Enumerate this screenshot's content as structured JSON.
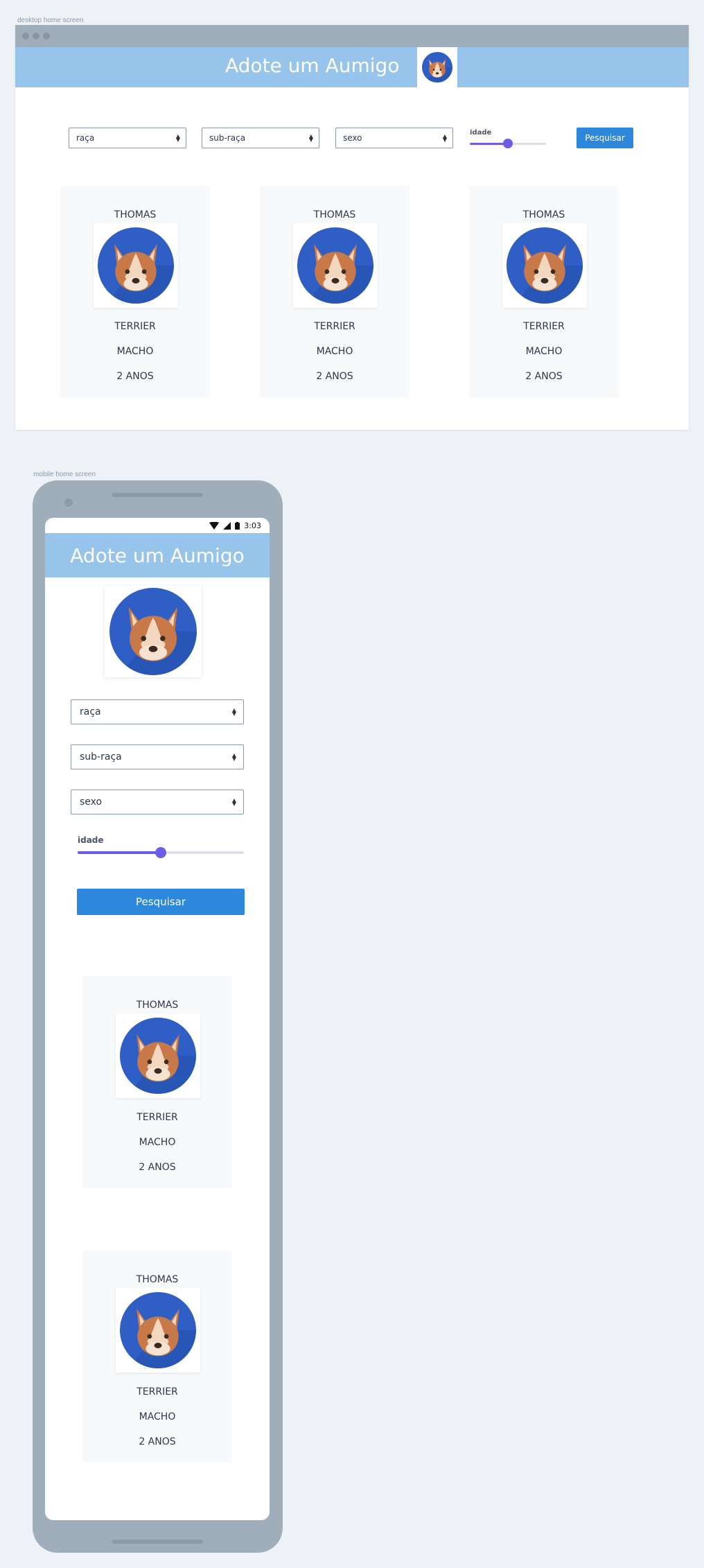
{
  "labels": {
    "desktop_frame": "desktop home screen",
    "mobile_frame": "mobile home screen"
  },
  "app": {
    "title": "Adote um Aumigo"
  },
  "filters": {
    "breed": "raça",
    "sub_breed": "sub-raça",
    "sex": "sexo",
    "age_label": "idade",
    "desktop_age_level": 0.5,
    "mobile_age_level": 0.5,
    "search_button": "Pesquisar"
  },
  "statusbar": {
    "time": "3:03"
  },
  "desktop_cards": [
    {
      "name": "THOMAS",
      "breed": "TERRIER",
      "sex": "MACHO",
      "age": "2 ANOS"
    },
    {
      "name": "THOMAS",
      "breed": "TERRIER",
      "sex": "MACHO",
      "age": "2 ANOS"
    },
    {
      "name": "THOMAS",
      "breed": "TERRIER",
      "sex": "MACHO",
      "age": "2 ANOS"
    }
  ],
  "mobile_cards": [
    {
      "name": "THOMAS",
      "breed": "TERRIER",
      "sex": "MACHO",
      "age": "2 ANOS"
    },
    {
      "name": "THOMAS",
      "breed": "TERRIER",
      "sex": "MACHO",
      "age": "2 ANOS"
    }
  ],
  "colors": {
    "header": "#97c4ea",
    "button": "#2d88dc",
    "slider": "#6c5ce7",
    "dog_bg": "#2f5fc4"
  },
  "icons": {
    "dog_avatar": "dog-avatar-icon"
  }
}
